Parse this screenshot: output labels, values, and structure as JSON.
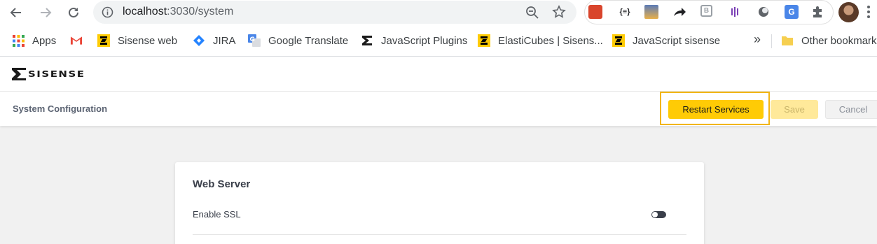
{
  "browser": {
    "url_host": "localhost",
    "url_rest": ":3030/system",
    "extension_labels": [
      "{≡}"
    ],
    "bookmarks": [
      {
        "label": "Apps",
        "icon": "apps-grid-icon"
      },
      {
        "label": "",
        "icon": "gmail-icon"
      },
      {
        "label": "Sisense web",
        "icon": "sisense-icon"
      },
      {
        "label": "JIRA",
        "icon": "jira-icon"
      },
      {
        "label": "Google Translate",
        "icon": "google-translate-icon"
      },
      {
        "label": "JavaScript Plugins",
        "icon": "sisense-dark-icon"
      },
      {
        "label": "ElastiCubes | Sisens...",
        "icon": "sisense-icon"
      },
      {
        "label": "JavaScript sisense",
        "icon": "sisense-icon"
      }
    ],
    "overflow_label": "»",
    "other_bookmarks": "Other bookmarks"
  },
  "app": {
    "logo_text": "SISENSE",
    "page_title": "System Configuration",
    "buttons": {
      "restart": "Restart Services",
      "save": "Save",
      "cancel": "Cancel"
    },
    "card": {
      "title": "Web Server",
      "setting_label": "Enable SSL",
      "setting_value": false
    }
  },
  "colors": {
    "accent": "#ffcb05",
    "highlight": "#f2b514",
    "save_disabled": "#ffe99a"
  }
}
